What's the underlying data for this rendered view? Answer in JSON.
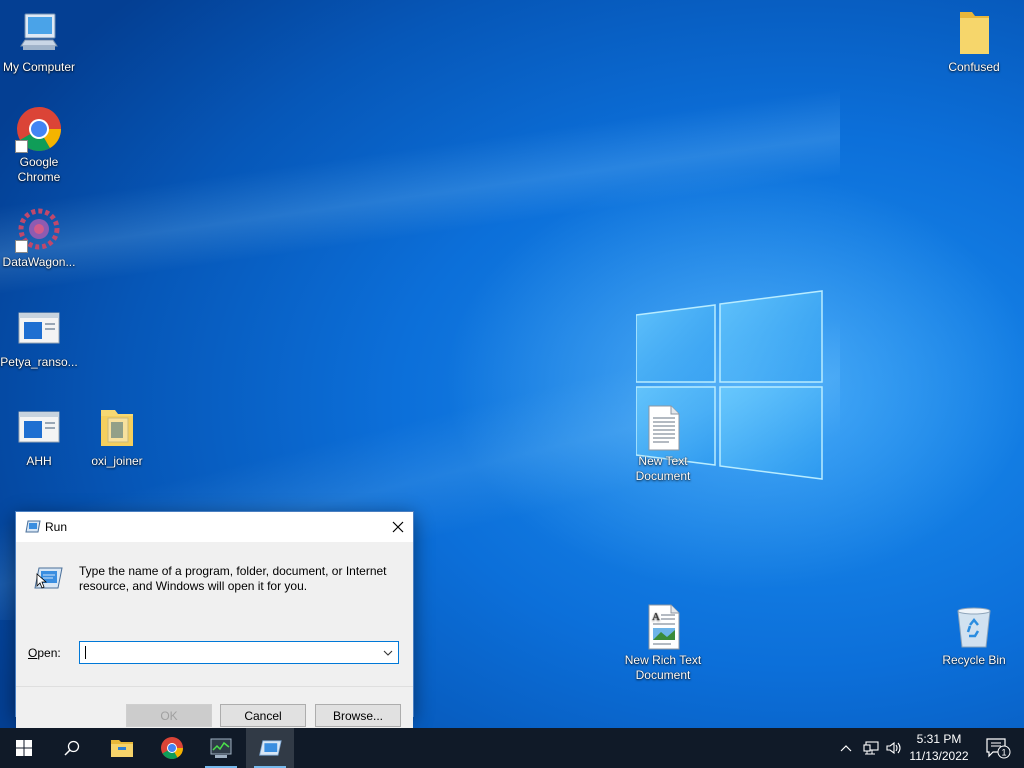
{
  "desktop": {
    "icons": [
      {
        "label": "My Computer",
        "icon": "computer-icon"
      },
      {
        "label": "Google Chrome",
        "icon": "chrome-icon"
      },
      {
        "label": "DataWagon...",
        "icon": "app-icon"
      },
      {
        "label": "Petya_ranso...",
        "icon": "executable-icon"
      },
      {
        "label": "AHH",
        "icon": "executable-icon"
      },
      {
        "label": "oxi_joiner",
        "icon": "folder-icon"
      },
      {
        "label": "Confused",
        "icon": "folder-icon"
      },
      {
        "label": "New Text Document",
        "icon": "text-document-icon"
      },
      {
        "label": "New Rich Text Document",
        "icon": "rich-text-document-icon"
      },
      {
        "label": "Recycle Bin",
        "icon": "recycle-bin-icon"
      }
    ]
  },
  "run_dialog": {
    "title": "Run",
    "description": "Type the name of a program, folder, document, or Internet resource, and Windows will open it for you.",
    "open_label_accel": "O",
    "open_label_rest": "pen:",
    "open_value": "",
    "ok_label": "OK",
    "cancel_label": "Cancel",
    "browse_label": "Browse..."
  },
  "taskbar": {
    "items": [
      "start-icon",
      "search-icon",
      "file-explorer-icon",
      "chrome-icon",
      "task-manager-icon",
      "run-icon"
    ],
    "time": "5:31 PM",
    "date": "11/13/2022",
    "notification_count": "1"
  },
  "colors": {
    "accent": "#0078d7",
    "taskbar": "#101a28",
    "wallpaper": "#0c6fd9"
  }
}
